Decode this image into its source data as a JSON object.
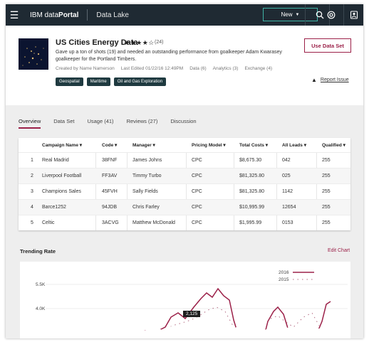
{
  "nav": {
    "brand_prefix": "IBM data",
    "brand_bold": "Portal",
    "section": "Data Lake",
    "new_label": "New",
    "icons": [
      "menu-icon",
      "search-icon",
      "help-icon",
      "user-icon"
    ]
  },
  "dataset": {
    "title": "US Cities Energy Data",
    "stars": "★★★★☆",
    "rating_count": "(24)",
    "description": "Gave up a ton of shots (19) and needed an outstanding performance from goalkeeper Adam Kwarasey goalkeeper for the Portland Timbers.",
    "created_by": "Created by Name Namerson",
    "last_edited": "Last Edited 01/22/16 12:49PM",
    "data": "Data (6)",
    "analytics": "Analytics (3)",
    "exchange": "Exchange (4)",
    "tags": [
      "Geospatial",
      "Maritime",
      "Oil and Gas Exploration"
    ],
    "use_button": "Use Data Set",
    "report_label": "Report Issue",
    "colors": {
      "accent": "#9b2048",
      "nav": "#1f2a33",
      "tag": "#1f3a40",
      "new_border": "#3fb3a6"
    }
  },
  "tabs": [
    "Overview",
    "Data Set",
    "Usage (41)",
    "Reviews (27)",
    "Discussion"
  ],
  "table": {
    "headers": [
      "Campaign Name",
      "Code",
      "Manager",
      "Pricing Model",
      "Total Costs",
      "All Leads",
      "Qualified"
    ],
    "rows": [
      [
        "1",
        "Real Madrid",
        "38FNF",
        "James Johns",
        "CPC",
        "$8,675.30",
        "042",
        "255"
      ],
      [
        "2",
        "Liverpool Football",
        "FF3AV",
        "Timmy Turbo",
        "CPC",
        "$81,325.80",
        "025",
        "255"
      ],
      [
        "3",
        "Champions Sales",
        "45FVH",
        "Sally Fields",
        "CPC",
        "$81,325.80",
        "1142",
        "255"
      ],
      [
        "4",
        "Barce1252",
        "94JDB",
        "Chris Farley",
        "CPC",
        "$10,995.99",
        "12654",
        "255"
      ],
      [
        "5",
        "Celtic",
        "3ACVG",
        "Matthew McDonald",
        "CPC",
        "$1,995.99",
        "0153",
        "255"
      ]
    ]
  },
  "trending": {
    "title": "Trending Rate",
    "edit_label": "Edit Chart",
    "legend": [
      "2016",
      "2015"
    ],
    "y_ticks": [
      "5.5K",
      "4.0K"
    ],
    "tooltip": "2,125"
  }
}
